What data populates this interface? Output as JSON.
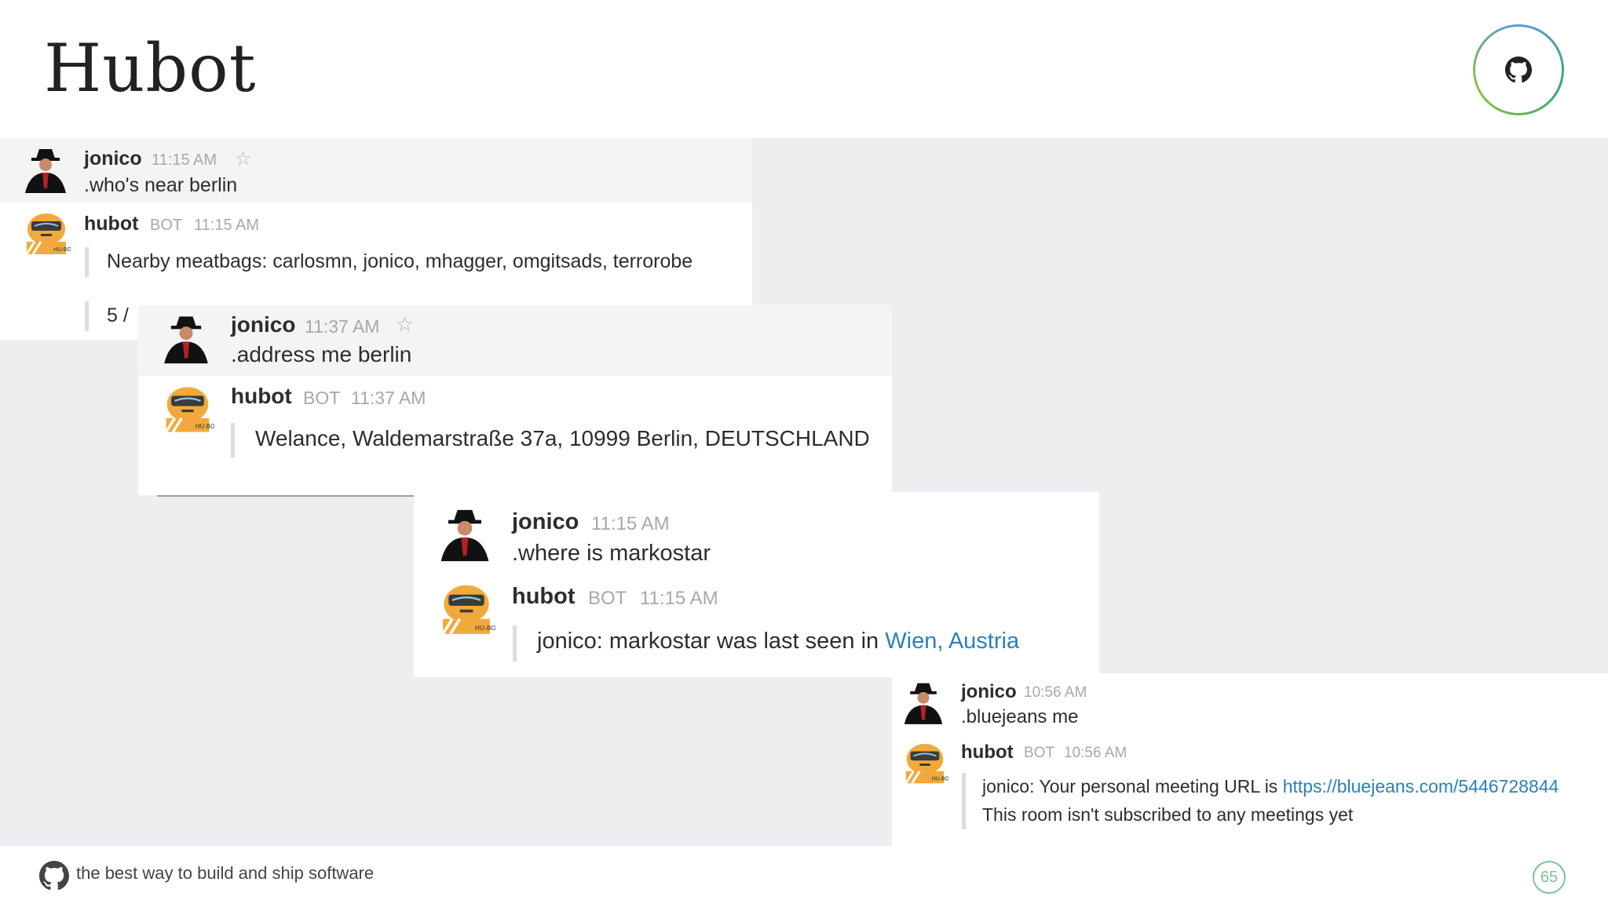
{
  "slide": {
    "title": "Hubot",
    "footer_text": "the best way to build and ship software",
    "page_number": "65"
  },
  "icons": {
    "github": "github-octocat-icon",
    "star": "star-icon",
    "avatar_user": "user-avatar",
    "avatar_bot": "hubot-avatar"
  },
  "colors": {
    "link": "#2a80b9",
    "name": "#2c2d30",
    "meta": "#a8a8ab",
    "accent_ring": "#39a96b"
  },
  "panels": [
    {
      "user": {
        "name": "jonico",
        "time": "11:15 AM",
        "text": ".who's near berlin"
      },
      "bot": {
        "name": "hubot",
        "tag": "BOT",
        "time": "11:15 AM",
        "text": "Nearby meatbags: carlosmn, jonico, mhagger, omgitsads, terrorobe",
        "extra": "5 /"
      }
    },
    {
      "user": {
        "name": "jonico",
        "time": "11:37 AM",
        "text": ".address me berlin"
      },
      "bot": {
        "name": "hubot",
        "tag": "BOT",
        "time": "11:37 AM",
        "text": "Welance, Waldemarstraße 37a, 10999 Berlin, DEUTSCHLAND"
      }
    },
    {
      "user": {
        "name": "jonico",
        "time": "11:15 AM",
        "text": ".where is markostar"
      },
      "bot": {
        "name": "hubot",
        "tag": "BOT",
        "time": "11:15 AM",
        "text_prefix": "jonico: markostar was last seen in ",
        "link": "Wien, Austria"
      }
    },
    {
      "user": {
        "name": "jonico",
        "time": "10:56 AM",
        "text": ".bluejeans me"
      },
      "bot": {
        "name": "hubot",
        "tag": "BOT",
        "time": "10:56 AM",
        "text_prefix": "jonico: Your personal meeting URL is ",
        "link": "https://bluejeans.com/5446728844",
        "line2": "This room isn't subscribed to any meetings yet"
      }
    }
  ]
}
